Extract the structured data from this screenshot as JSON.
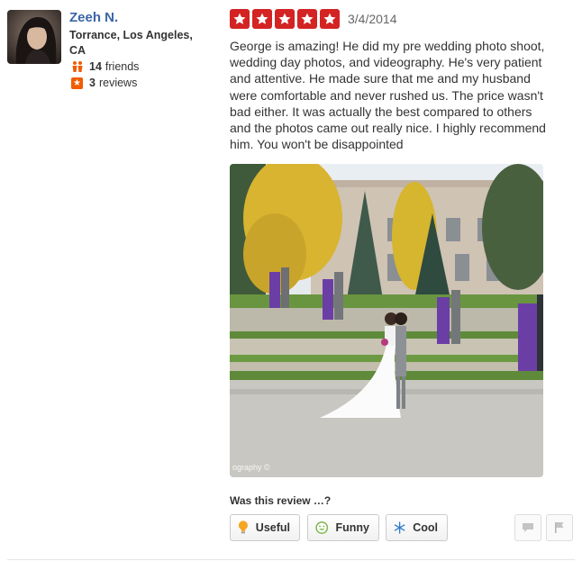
{
  "user": {
    "name": "Zeeh N.",
    "location": "Torrance, Los Angeles, CA",
    "friends_count": "14",
    "friends_label": "friends",
    "reviews_count": "3",
    "reviews_label": "reviews"
  },
  "review": {
    "rating": 5,
    "max_rating": 5,
    "date": "3/4/2014",
    "text": "George is amazing! He did my pre wedding photo shoot, wedding day photos, and videography. He's very patient and attentive. He made sure that me and my husband were comfortable and never rushed us. The price wasn't bad either. It was actually the best compared to others and the photos came out really nice. I highly recommend him. You won't be disappointed",
    "photo_credit": "ography ©"
  },
  "feedback": {
    "question": "Was this review …?",
    "useful_label": "Useful",
    "funny_label": "Funny",
    "cool_label": "Cool"
  },
  "colors": {
    "star_red": "#d32323",
    "user_link": "#3b65a7",
    "review_orange": "#f15c00"
  }
}
